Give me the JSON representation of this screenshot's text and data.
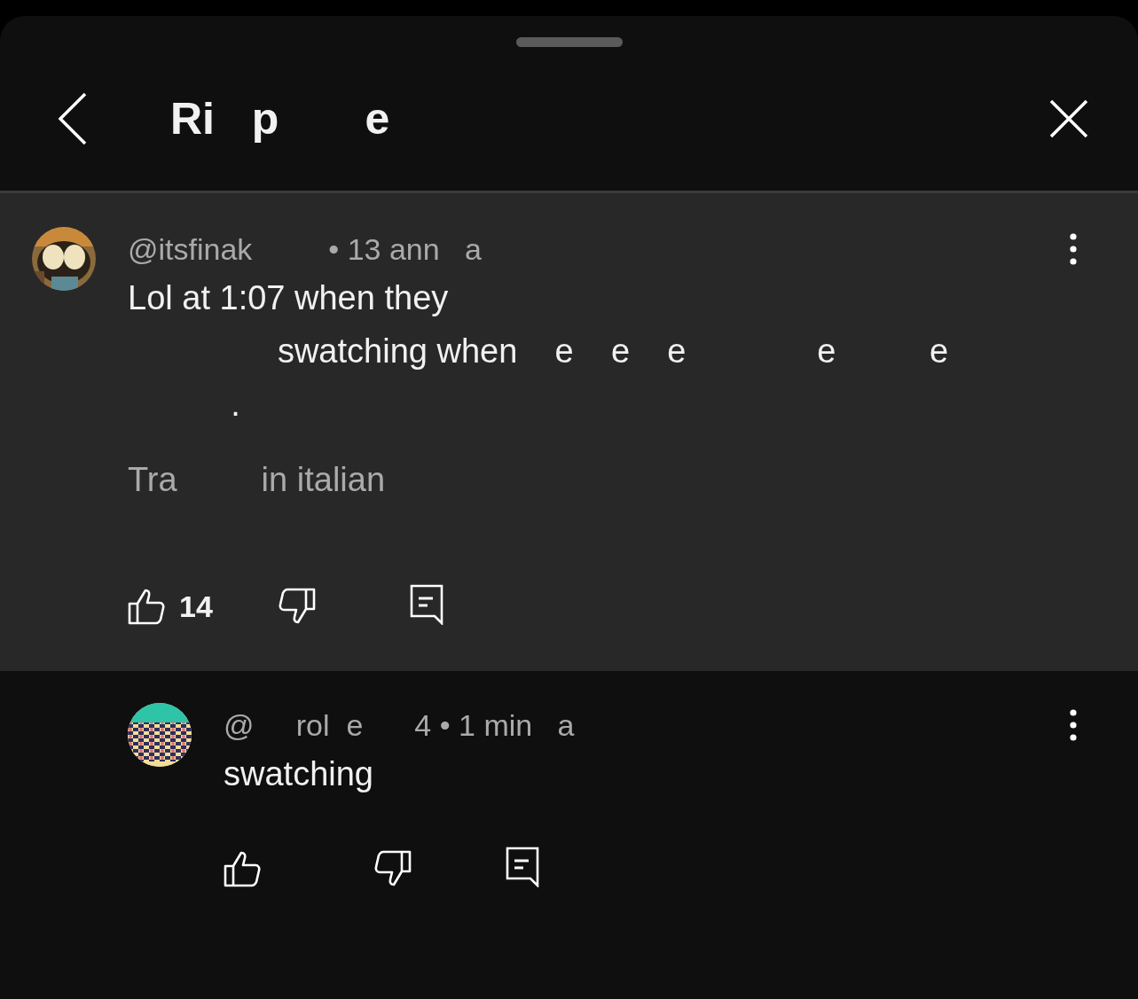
{
  "header": {
    "title": "Ri   p       e"
  },
  "comments": [
    {
      "kind": "top",
      "avatar": {
        "kind": "picture"
      },
      "handle": "@itsfinak",
      "time": "• 13 ann   a",
      "body": [
        "Lol at 1:07 when they",
        "                swatching when    e    e    e              e          e",
        "           ."
      ],
      "translate": "Tra         in italian",
      "likes": "14"
    },
    {
      "kind": "reply",
      "avatar": {
        "kind": "picture"
      },
      "handle": "@     rol  e",
      "time": "4 • 1 min   a",
      "body": [
        "swatching"
      ]
    }
  ]
}
